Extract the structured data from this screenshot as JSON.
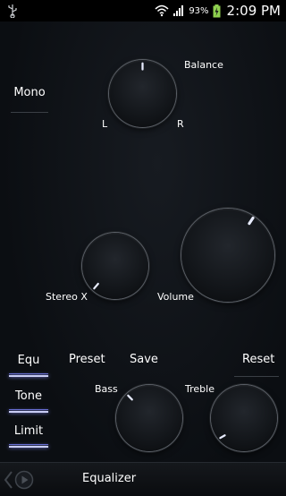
{
  "status_bar": {
    "battery_percent": "93%",
    "time": "2:09 PM",
    "icons": [
      "usb-icon",
      "wifi-icon",
      "signal-icon",
      "battery-charging-icon"
    ]
  },
  "mono": {
    "label": "Mono"
  },
  "balance": {
    "label": "Balance",
    "left_label": "L",
    "right_label": "R"
  },
  "stereo_x": {
    "label": "Stereo X"
  },
  "volume": {
    "label": "Volume"
  },
  "sidebar": {
    "equ_label": "Equ",
    "tone_label": "Tone",
    "limit_label": "Limit"
  },
  "toolbar": {
    "preset_label": "Preset",
    "save_label": "Save",
    "reset_label": "Reset"
  },
  "bass": {
    "label": "Bass"
  },
  "treble": {
    "label": "Treble"
  },
  "bottom_bar": {
    "title": "Equalizer",
    "icons": [
      "chevron-left-icon",
      "play-icon"
    ]
  },
  "colors": {
    "accent": "#c9cdf5",
    "background": "#0c0f13"
  }
}
